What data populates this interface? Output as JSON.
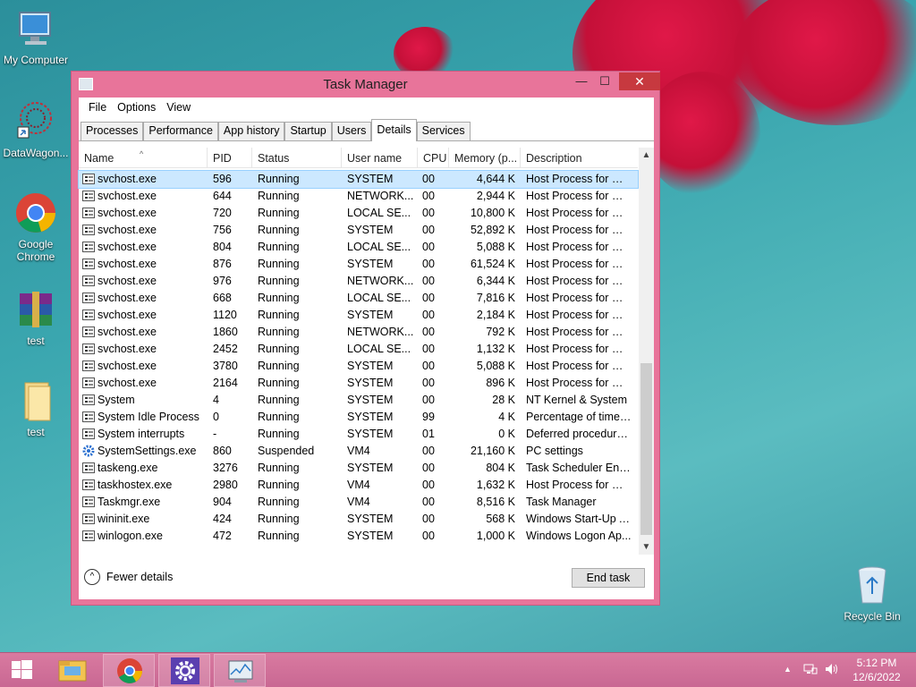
{
  "desktop": {
    "icons": [
      {
        "label": "My Computer"
      },
      {
        "label": "DataWagon..."
      },
      {
        "label": "Google Chrome"
      },
      {
        "label": "test"
      },
      {
        "label": "test"
      },
      {
        "label": "Recycle Bin"
      }
    ]
  },
  "window": {
    "title": "Task Manager",
    "controls": {
      "minimize": "—",
      "maximize": "☐",
      "close": "✕"
    },
    "menu": [
      "File",
      "Options",
      "View"
    ],
    "tabs": [
      "Processes",
      "Performance",
      "App history",
      "Startup",
      "Users",
      "Details",
      "Services"
    ],
    "active_tab": "Details",
    "columns": [
      "Name",
      "PID",
      "Status",
      "User name",
      "CPU",
      "Memory (p...",
      "Description"
    ],
    "rows": [
      {
        "name": "svchost.exe",
        "pid": "596",
        "status": "Running",
        "user": "SYSTEM",
        "cpu": "00",
        "mem": "4,644 K",
        "desc": "Host Process for Wi..."
      },
      {
        "name": "svchost.exe",
        "pid": "644",
        "status": "Running",
        "user": "NETWORK...",
        "cpu": "00",
        "mem": "2,944 K",
        "desc": "Host Process for Wi..."
      },
      {
        "name": "svchost.exe",
        "pid": "720",
        "status": "Running",
        "user": "LOCAL SE...",
        "cpu": "00",
        "mem": "10,800 K",
        "desc": "Host Process for Wi..."
      },
      {
        "name": "svchost.exe",
        "pid": "756",
        "status": "Running",
        "user": "SYSTEM",
        "cpu": "00",
        "mem": "52,892 K",
        "desc": "Host Process for Wi..."
      },
      {
        "name": "svchost.exe",
        "pid": "804",
        "status": "Running",
        "user": "LOCAL SE...",
        "cpu": "00",
        "mem": "5,088 K",
        "desc": "Host Process for Wi..."
      },
      {
        "name": "svchost.exe",
        "pid": "876",
        "status": "Running",
        "user": "SYSTEM",
        "cpu": "00",
        "mem": "61,524 K",
        "desc": "Host Process for Wi..."
      },
      {
        "name": "svchost.exe",
        "pid": "976",
        "status": "Running",
        "user": "NETWORK...",
        "cpu": "00",
        "mem": "6,344 K",
        "desc": "Host Process for Wi..."
      },
      {
        "name": "svchost.exe",
        "pid": "668",
        "status": "Running",
        "user": "LOCAL SE...",
        "cpu": "00",
        "mem": "7,816 K",
        "desc": "Host Process for Wi..."
      },
      {
        "name": "svchost.exe",
        "pid": "1120",
        "status": "Running",
        "user": "SYSTEM",
        "cpu": "00",
        "mem": "2,184 K",
        "desc": "Host Process for Wi..."
      },
      {
        "name": "svchost.exe",
        "pid": "1860",
        "status": "Running",
        "user": "NETWORK...",
        "cpu": "00",
        "mem": "792 K",
        "desc": "Host Process for Wi..."
      },
      {
        "name": "svchost.exe",
        "pid": "2452",
        "status": "Running",
        "user": "LOCAL SE...",
        "cpu": "00",
        "mem": "1,132 K",
        "desc": "Host Process for Wi..."
      },
      {
        "name": "svchost.exe",
        "pid": "3780",
        "status": "Running",
        "user": "SYSTEM",
        "cpu": "00",
        "mem": "5,088 K",
        "desc": "Host Process for Wi..."
      },
      {
        "name": "svchost.exe",
        "pid": "2164",
        "status": "Running",
        "user": "SYSTEM",
        "cpu": "00",
        "mem": "896 K",
        "desc": "Host Process for Wi..."
      },
      {
        "name": "System",
        "pid": "4",
        "status": "Running",
        "user": "SYSTEM",
        "cpu": "00",
        "mem": "28 K",
        "desc": "NT Kernel & System"
      },
      {
        "name": "System Idle Process",
        "pid": "0",
        "status": "Running",
        "user": "SYSTEM",
        "cpu": "99",
        "mem": "4 K",
        "desc": "Percentage of time t..."
      },
      {
        "name": "System interrupts",
        "pid": "-",
        "status": "Running",
        "user": "SYSTEM",
        "cpu": "01",
        "mem": "0 K",
        "desc": "Deferred procedure ..."
      },
      {
        "name": "SystemSettings.exe",
        "pid": "860",
        "status": "Suspended",
        "user": "VM4",
        "cpu": "00",
        "mem": "21,160 K",
        "desc": "PC settings"
      },
      {
        "name": "taskeng.exe",
        "pid": "3276",
        "status": "Running",
        "user": "SYSTEM",
        "cpu": "00",
        "mem": "804 K",
        "desc": "Task Scheduler Engi..."
      },
      {
        "name": "taskhostex.exe",
        "pid": "2980",
        "status": "Running",
        "user": "VM4",
        "cpu": "00",
        "mem": "1,632 K",
        "desc": "Host Process for Wi..."
      },
      {
        "name": "Taskmgr.exe",
        "pid": "904",
        "status": "Running",
        "user": "VM4",
        "cpu": "00",
        "mem": "8,516 K",
        "desc": "Task Manager"
      },
      {
        "name": "wininit.exe",
        "pid": "424",
        "status": "Running",
        "user": "SYSTEM",
        "cpu": "00",
        "mem": "568 K",
        "desc": "Windows Start-Up A..."
      },
      {
        "name": "winlogon.exe",
        "pid": "472",
        "status": "Running",
        "user": "SYSTEM",
        "cpu": "00",
        "mem": "1,000 K",
        "desc": "Windows Logon Ap..."
      }
    ],
    "fewer_details": "Fewer details",
    "end_task": "End task"
  },
  "taskbar": {
    "time": "5:12 PM",
    "date": "12/6/2022"
  }
}
